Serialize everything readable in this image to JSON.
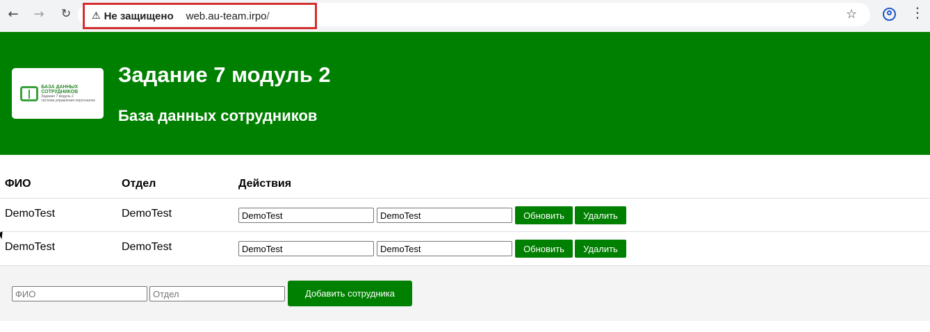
{
  "browser": {
    "security_label": "Не защищено",
    "url_host": "web.au-team.irpo",
    "url_tail": "/",
    "warning_icon": "warning-triangle-icon",
    "accent_color": "#1a56c7",
    "highlight_color": "#d32f2f"
  },
  "header": {
    "title": "Задание 7 модуль 2",
    "subtitle": "База данных сотрудников",
    "background_color": "#008000",
    "logo": {
      "line1": "БАЗА ДАННЫХ",
      "line2": "СОТРУДНИКОВ",
      "line3": "Задание 7 модуль 2",
      "line4": "система управления персоналом"
    }
  },
  "table": {
    "headers": [
      "ФИО",
      "Отдел",
      "Действия"
    ],
    "rows": [
      {
        "fio": "DemoTest",
        "dept": "DemoTest",
        "fio_input": "DemoTest",
        "dept_input": "DemoTest",
        "update_label": "Обновить",
        "delete_label": "Удалить"
      },
      {
        "fio": "DemoTest",
        "dept": "DemoTest",
        "fio_input": "DemoTest",
        "dept_input": "DemoTest",
        "update_label": "Обновить",
        "delete_label": "Удалить"
      }
    ]
  },
  "add_form": {
    "fio_placeholder": "ФИО",
    "dept_placeholder": "Отдел",
    "add_label": "Добавить сотрудника"
  }
}
